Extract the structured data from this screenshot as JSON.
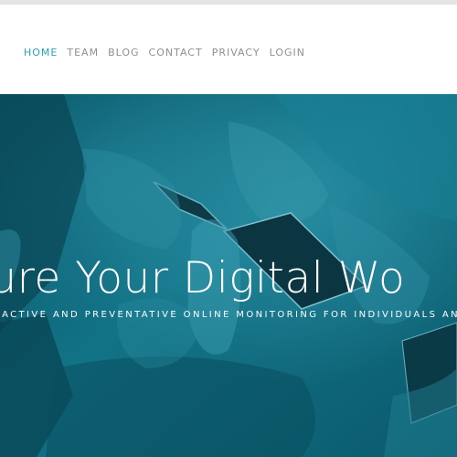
{
  "nav": {
    "items": [
      {
        "label": "HOME",
        "active": true
      },
      {
        "label": "TEAM",
        "active": false
      },
      {
        "label": "BLOG",
        "active": false
      },
      {
        "label": "CONTACT",
        "active": false
      },
      {
        "label": "PRIVACY",
        "active": false
      },
      {
        "label": "LOGIN",
        "active": false
      }
    ]
  },
  "hero": {
    "title": "cure Your Digital Wo",
    "subtitle": "OACTIVE AND PREVENTATIVE ONLINE MONITORING FOR INDIVIDUALS AND"
  },
  "colors": {
    "accent": "#2a9fbf",
    "nav_text": "#8f8f8f",
    "hero_overlay": "#0c5f73"
  }
}
